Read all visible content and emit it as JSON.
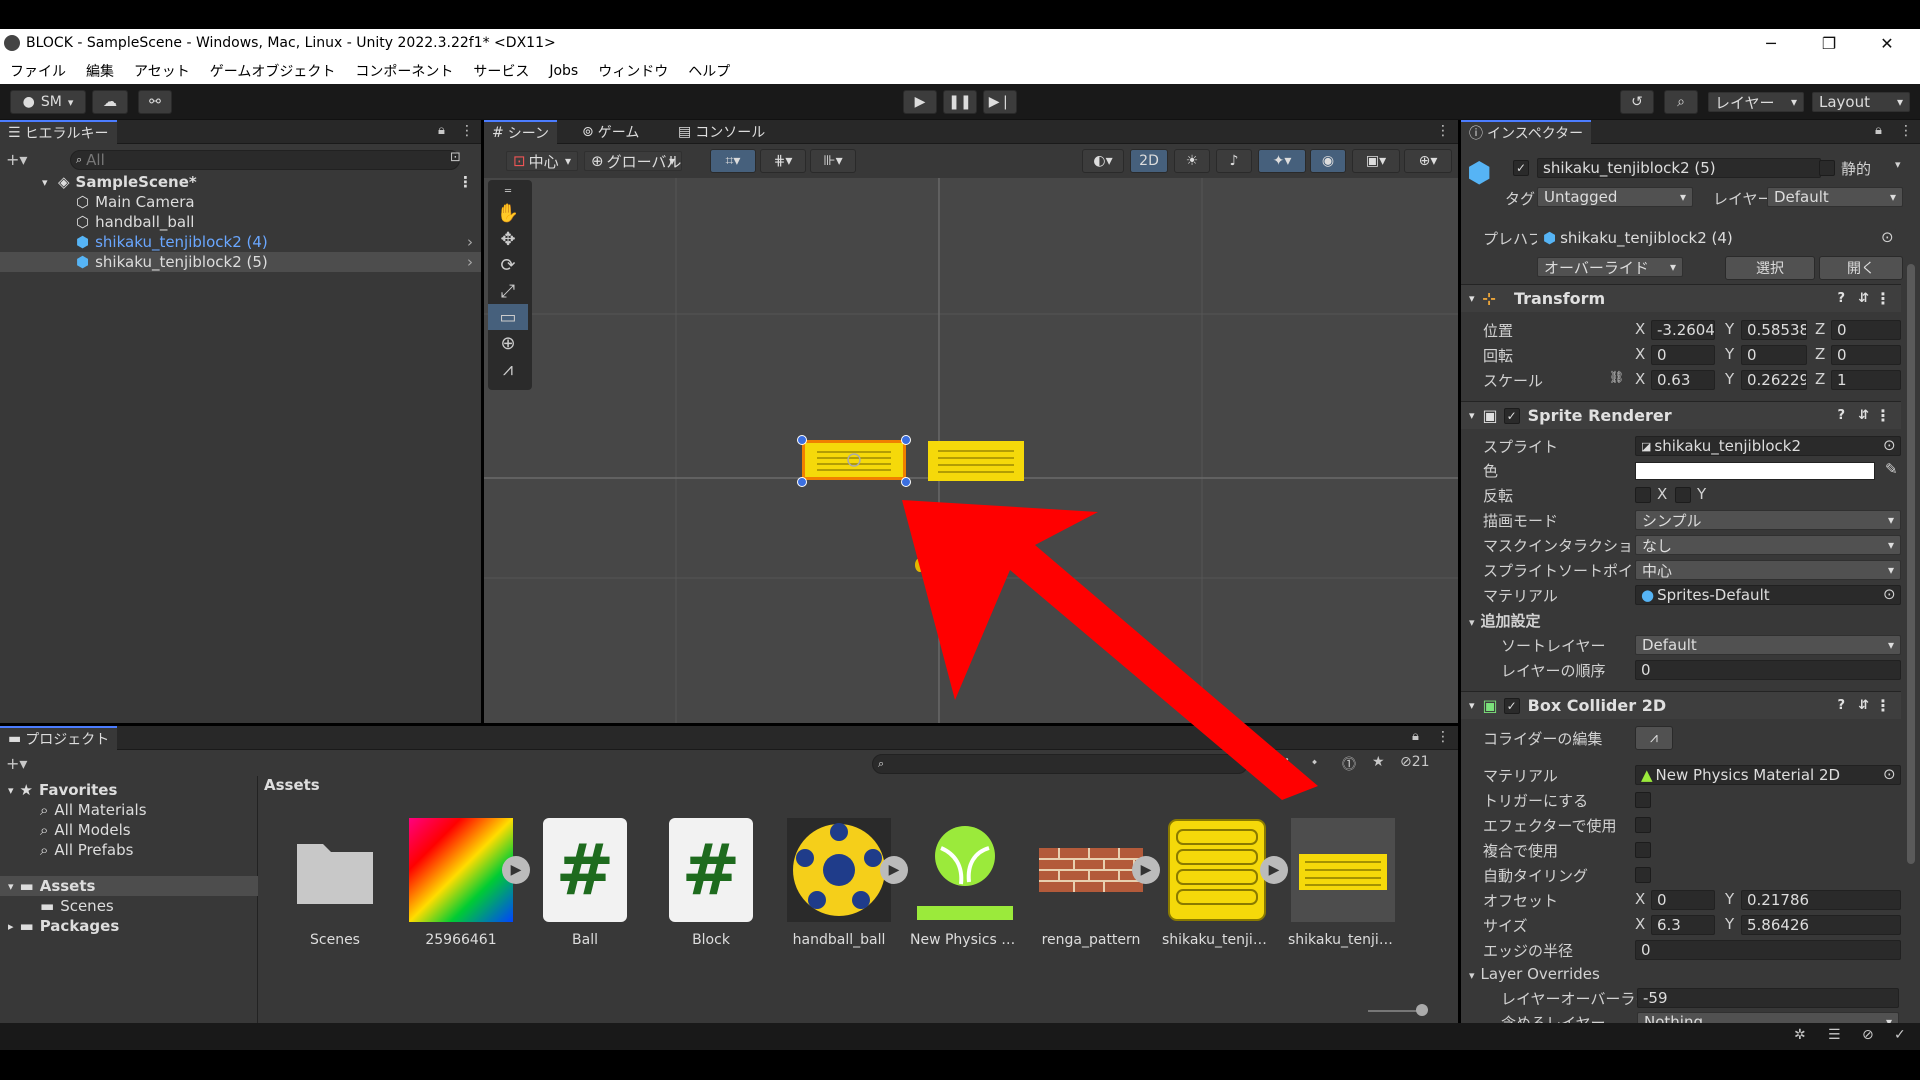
{
  "window": {
    "title": "BLOCK - SampleScene - Windows, Mac, Linux - Unity 2022.3.22f1* <DX11>",
    "minimize": "─",
    "maximize": "❐",
    "close": "✕"
  },
  "menu": [
    "ファイル",
    "編集",
    "アセット",
    "ゲームオブジェクト",
    "コンポーネント",
    "サービス",
    "Jobs",
    "ウィンドウ",
    "ヘルプ"
  ],
  "toolbar": {
    "account": "SM",
    "layers": "レイヤー",
    "layout": "Layout"
  },
  "hierarchy": {
    "tab": "ヒエラルキー",
    "search_placeholder": "All",
    "scene": "SampleScene*",
    "items": [
      "Main Camera",
      "handball_ball",
      "shikaku_tenjiblock2 (4)",
      "shikaku_tenjiblock2 (5)"
    ]
  },
  "center_tabs": [
    "シーン",
    "ゲーム",
    "コンソール"
  ],
  "scene_toolbar": {
    "pivot": "中心",
    "space": "グローバル",
    "mode_2d": "2D"
  },
  "project": {
    "tab": "プロジェクト",
    "favorites": "Favorites",
    "fav_items": [
      "All Materials",
      "All Models",
      "All Prefabs"
    ],
    "assets": "Assets",
    "scenes": "Scenes",
    "packages": "Packages",
    "breadcrumb": "Assets",
    "hidden_count": "21",
    "asset_items": [
      "Scenes",
      "25966461",
      "Ball",
      "Block",
      "handball_ball",
      "New Physics Ma…",
      "renga_pattern",
      "shikaku_tenjibl…",
      "shikaku_tenjibl…"
    ]
  },
  "inspector": {
    "tab": "インスペクター",
    "object_name": "shikaku_tenjiblock2 (5)",
    "static_label": "静的",
    "tag_label": "タグ",
    "tag_value": "Untagged",
    "layer_label": "レイヤー",
    "layer_value": "Default",
    "prefab_label": "プレハブ",
    "prefab_value": "shikaku_tenjiblock2 (4)",
    "overrides": "オーバーライド",
    "select": "選択",
    "open": "開く",
    "transform": {
      "title": "Transform",
      "position_label": "位置",
      "rotation_label": "回転",
      "scale_label": "スケール",
      "pos": {
        "x": "-3.2604",
        "y": "0.58538",
        "z": "0"
      },
      "rot": {
        "x": "0",
        "y": "0",
        "z": "0"
      },
      "scale": {
        "x": "0.63",
        "y": "0.26229",
        "z": "1"
      }
    },
    "sprite_renderer": {
      "title": "Sprite Renderer",
      "sprite_label": "スプライト",
      "sprite_value": "shikaku_tenjiblock2",
      "color_label": "色",
      "flip_label": "反転",
      "flip_x": "X",
      "flip_y": "Y",
      "draw_mode_label": "描画モード",
      "draw_mode_value": "シンプル",
      "mask_label": "マスクインタラクション",
      "mask_value": "なし",
      "sort_point_label": "スプライトソートポイント",
      "sort_point_value": "中心",
      "material_label": "マテリアル",
      "material_value": "Sprites-Default",
      "additional_label": "追加設定",
      "sort_layer_label": "ソートレイヤー",
      "sort_layer_value": "Default",
      "order_label": "レイヤーの順序",
      "order_value": "0"
    },
    "box_collider": {
      "title": "Box Collider 2D",
      "edit_label": "コライダーの編集",
      "material_label": "マテリアル",
      "material_value": "New Physics Material 2D",
      "trigger_label": "トリガーにする",
      "effector_label": "エフェクターで使用",
      "composite_label": "複合で使用",
      "autotile_label": "自動タイリング",
      "offset_label": "オフセット",
      "offset": {
        "x": "0",
        "y": "0.21786"
      },
      "size_label": "サイズ",
      "size": {
        "x": "6.3",
        "y": "5.86426"
      },
      "edge_label": "エッジの半径",
      "edge_value": "0",
      "layer_overrides": "Layer Overrides",
      "layer_override_priority_label": "レイヤーオーバーライド",
      "layer_override_priority_value": "-59",
      "include_layers_label": "含めるレイヤー",
      "include_layers_value": "Nothing"
    }
  },
  "colors": {
    "accent": "#4c7dff",
    "selection": "#46607c",
    "arrow": "#ff0000",
    "block": "#f5d90a"
  }
}
